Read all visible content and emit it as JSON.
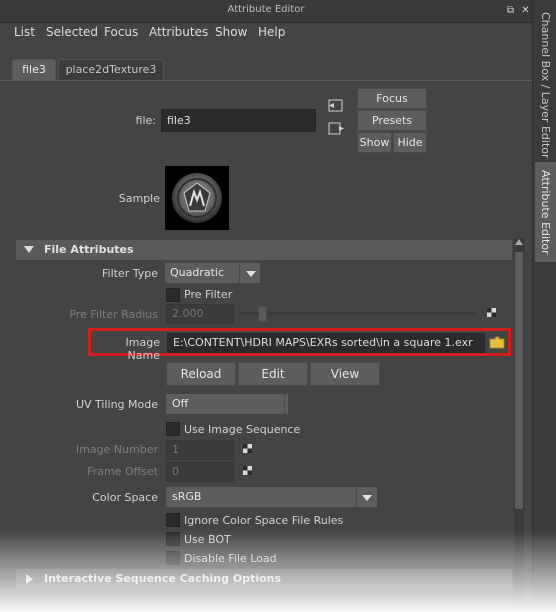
{
  "window": {
    "title": "Attribute Editor"
  },
  "menu": [
    "List",
    "Selected",
    "Focus",
    "Attributes",
    "Show",
    "Help"
  ],
  "tabs": [
    {
      "label": "file3",
      "active": true
    },
    {
      "label": "place2dTexture3",
      "active": false
    }
  ],
  "side_tabs": {
    "channel_box": "Channel Box / Layer Editor",
    "attribute_editor": "Attribute Editor"
  },
  "header": {
    "file_label": "file:",
    "file_value": "file3",
    "focus": "Focus",
    "presets": "Presets",
    "show": "Show",
    "hide": "Hide",
    "sample_label": "Sample"
  },
  "file_attributes": {
    "section_title": "File Attributes",
    "filter_type_label": "Filter Type",
    "filter_type_value": "Quadratic",
    "pre_filter_label": "Pre Filter",
    "pre_filter_radius_label": "Pre Filter Radius",
    "pre_filter_radius_value": "2.000",
    "pre_filter_radius_level": 0.08,
    "image_name_label": "Image Name",
    "image_name_value": "E:\\CONTENT\\HDRI MAPS\\EXRs sorted\\in a square 1.exr",
    "reload": "Reload",
    "edit": "Edit",
    "view": "View",
    "uv_tiling_label": "UV Tiling Mode",
    "uv_tiling_value": "Off",
    "use_image_sequence_label": "Use Image Sequence",
    "image_number_label": "Image Number",
    "image_number_value": "1",
    "frame_offset_label": "Frame Offset",
    "frame_offset_value": "0",
    "color_space_label": "Color Space",
    "color_space_value": "sRGB",
    "ignore_color_space_label": "Ignore Color Space File Rules",
    "use_bot_label": "Use BOT",
    "disable_file_load_label": "Disable File Load"
  },
  "collapsed_section": "Interactive Sequence Caching Options",
  "colors": {
    "highlight": "#d21e1e",
    "folder": "#e8c040",
    "panel": "#444444"
  }
}
